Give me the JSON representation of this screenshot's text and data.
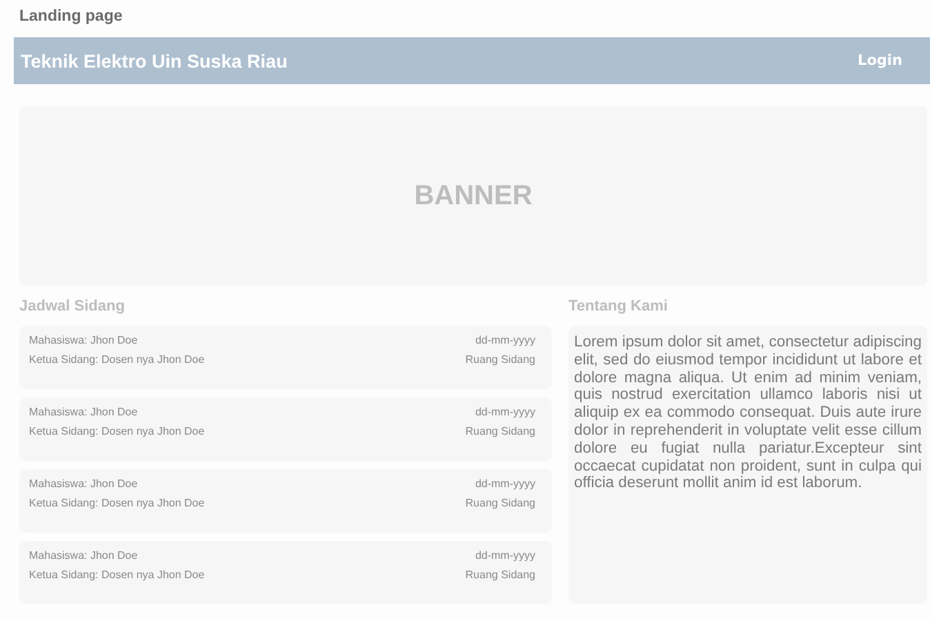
{
  "page_label": "Landing page",
  "navbar": {
    "title": "Teknik Elektro Uin Suska Riau",
    "login": "Login"
  },
  "banner": {
    "text": "BANNER"
  },
  "schedule": {
    "heading": "Jadwal Sidang",
    "items": [
      {
        "student": "Mahasiswa: Jhon Doe",
        "chair": "Ketua Sidang: Dosen nya Jhon Doe",
        "date": "dd-mm-yyyy",
        "room": "Ruang Sidang"
      },
      {
        "student": "Mahasiswa: Jhon Doe",
        "chair": "Ketua Sidang: Dosen nya Jhon Doe",
        "date": "dd-mm-yyyy",
        "room": "Ruang Sidang"
      },
      {
        "student": "Mahasiswa: Jhon Doe",
        "chair": "Ketua Sidang: Dosen nya Jhon Doe",
        "date": "dd-mm-yyyy",
        "room": "Ruang Sidang"
      },
      {
        "student": "Mahasiswa: Jhon Doe",
        "chair": "Ketua Sidang: Dosen nya Jhon Doe",
        "date": "dd-mm-yyyy",
        "room": "Ruang Sidang"
      }
    ]
  },
  "about": {
    "heading": "Tentang Kami",
    "text": "Lorem ipsum dolor sit amet, consectetur adipiscing elit, sed do eiusmod tempor incididunt ut labore et dolore magna aliqua. Ut enim ad minim veniam, quis nostrud exercitation ullamco laboris nisi ut aliquip ex ea commodo consequat. Duis aute irure dolor in reprehenderit in voluptate velit esse cillum dolore eu fugiat nulla pariatur.Excepteur sint occaecat cupidatat non proident, sunt in culpa qui officia deserunt mollit anim id est laborum."
  }
}
